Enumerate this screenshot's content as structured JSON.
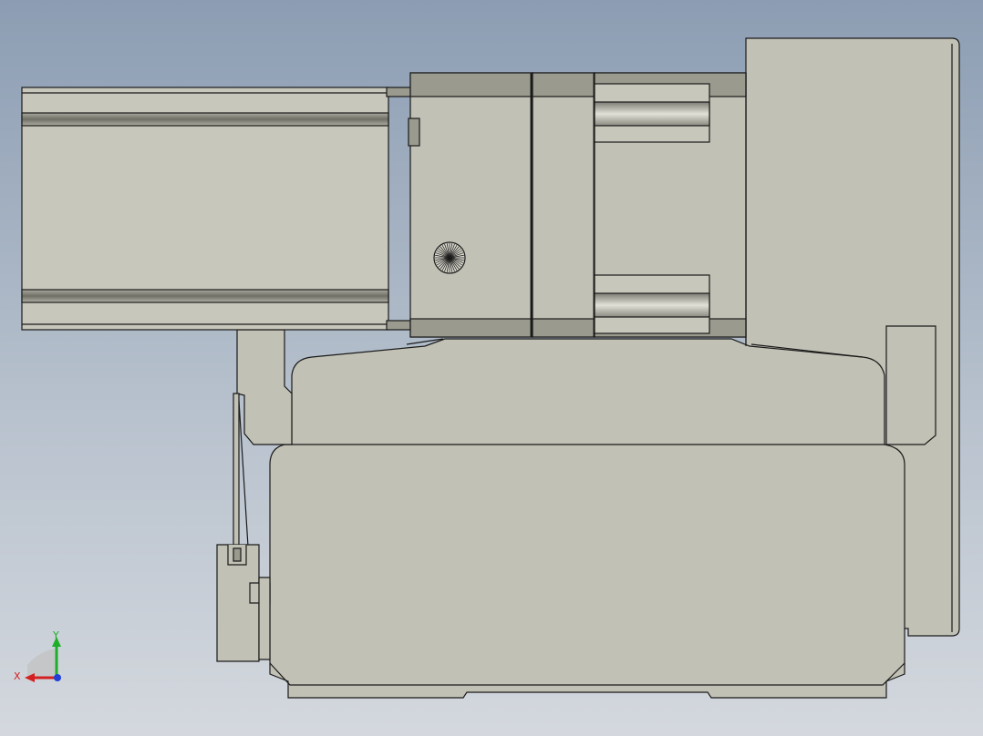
{
  "viewport": {
    "background_top": "#8c9db3",
    "background_bottom": "#d4d8de"
  },
  "model": {
    "body_color": "#c2c1b5",
    "shadow_color": "#9a9a8f",
    "edge_color": "#1a1a1a"
  },
  "triad": {
    "x_label": "X",
    "y_label": "Y",
    "x_color": "#d42020",
    "y_color": "#1fae2a",
    "z_color": "#1f3fd8"
  }
}
